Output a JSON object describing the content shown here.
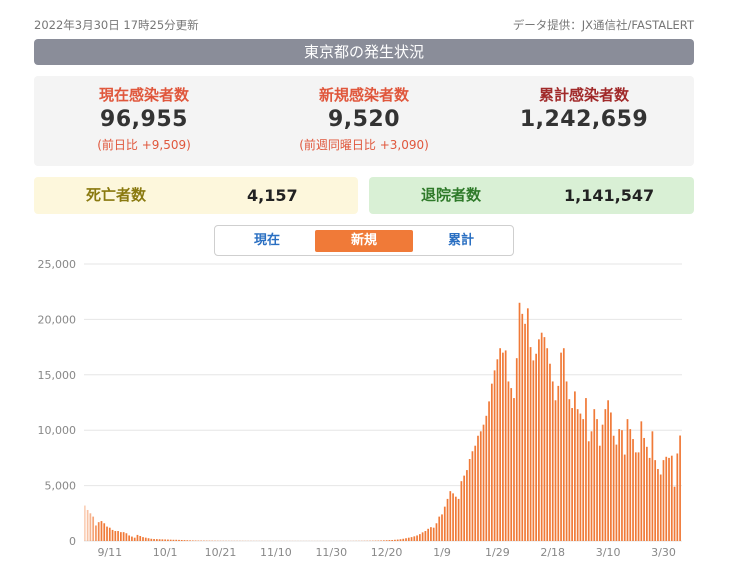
{
  "meta": {
    "updated": "2022年3月30日 17時25分更新",
    "source": "データ提供：JX通信社/FASTALERT"
  },
  "title": "東京都の発生状況",
  "stats": {
    "current": {
      "label": "現在感染者数",
      "value": "96,955",
      "sub": "(前日比 +9,509)",
      "color": "#e0573c"
    },
    "new": {
      "label": "新規感染者数",
      "value": "9,520",
      "sub": "(前週同曜日比 +3,090)",
      "color": "#e0573c"
    },
    "cumulative": {
      "label": "累計感染者数",
      "value": "1,242,659",
      "color": "#a12a2a"
    }
  },
  "deaths": {
    "label": "死亡者数",
    "value": "4,157",
    "color": "#8a7a10"
  },
  "discharged": {
    "label": "退院者数",
    "value": "1,141,547",
    "color": "#2f7a2a"
  },
  "tabs": [
    {
      "label": "現在",
      "active": false
    },
    {
      "label": "新規",
      "active": true
    },
    {
      "label": "累計",
      "active": false
    }
  ],
  "colors": {
    "bar": "#f07a38",
    "grid": "#e6e6e6",
    "tab_active": "#f07a38"
  },
  "chart_data": {
    "type": "bar",
    "ylim": [
      0,
      25000
    ],
    "y_ticks": [
      "25,000",
      "20,000",
      "15,000",
      "10,000",
      "5,000",
      "0"
    ],
    "x_ticks": [
      "9/11",
      "10/1",
      "10/21",
      "11/10",
      "11/30",
      "12/20",
      "1/9",
      "1/29",
      "2/18",
      "3/10",
      "3/30"
    ],
    "x_start_date": "2021-09-02",
    "values": [
      3200,
      2800,
      2500,
      2200,
      1400,
      1700,
      1800,
      1600,
      1300,
      1200,
      1000,
      900,
      900,
      800,
      800,
      700,
      500,
      400,
      300,
      550,
      450,
      350,
      300,
      250,
      200,
      180,
      170,
      160,
      150,
      140,
      130,
      120,
      110,
      110,
      100,
      90,
      80,
      70,
      60,
      50,
      45,
      40,
      38,
      35,
      32,
      30,
      28,
      25,
      22,
      20,
      20,
      18,
      18,
      17,
      16,
      15,
      15,
      14,
      13,
      12,
      12,
      11,
      11,
      10,
      10,
      9,
      9,
      9,
      8,
      8,
      8,
      8,
      7,
      7,
      7,
      7,
      6,
      6,
      6,
      6,
      6,
      6,
      6,
      6,
      6,
      6,
      6,
      5,
      5,
      5,
      6,
      7,
      7,
      8,
      8,
      10,
      10,
      12,
      14,
      15,
      17,
      20,
      22,
      25,
      30,
      35,
      40,
      50,
      60,
      70,
      80,
      90,
      110,
      130,
      160,
      200,
      250,
      300,
      350,
      420,
      500,
      620,
      780,
      900,
      1100,
      1250,
      1200,
      1600,
      2200,
      2400,
      3100,
      3800,
      4500,
      4300,
      4000,
      3800,
      5400,
      5900,
      6400,
      7400,
      8100,
      8600,
      9500,
      9900,
      10500,
      11300,
      12600,
      14200,
      15400,
      16400,
      17400,
      17000,
      17200,
      14400,
      13800,
      12900,
      16500,
      21500,
      20500,
      19600,
      21000,
      17500,
      16300,
      16900,
      18200,
      18800,
      18400,
      17400,
      16000,
      14400,
      12700,
      14000,
      17000,
      17400,
      14400,
      12800,
      12000,
      13500,
      11900,
      11500,
      11000,
      12900,
      9000,
      9900,
      11900,
      11000,
      8600,
      10500,
      11900,
      12700,
      11600,
      9500,
      8700,
      10100,
      10000,
      7800,
      11000,
      10100,
      9200,
      8000,
      8000,
      10800,
      9300,
      8500,
      7500,
      9900,
      7300,
      6500,
      6000,
      7300,
      7600,
      7500,
      7700,
      4900,
      7900,
      9520
    ]
  }
}
